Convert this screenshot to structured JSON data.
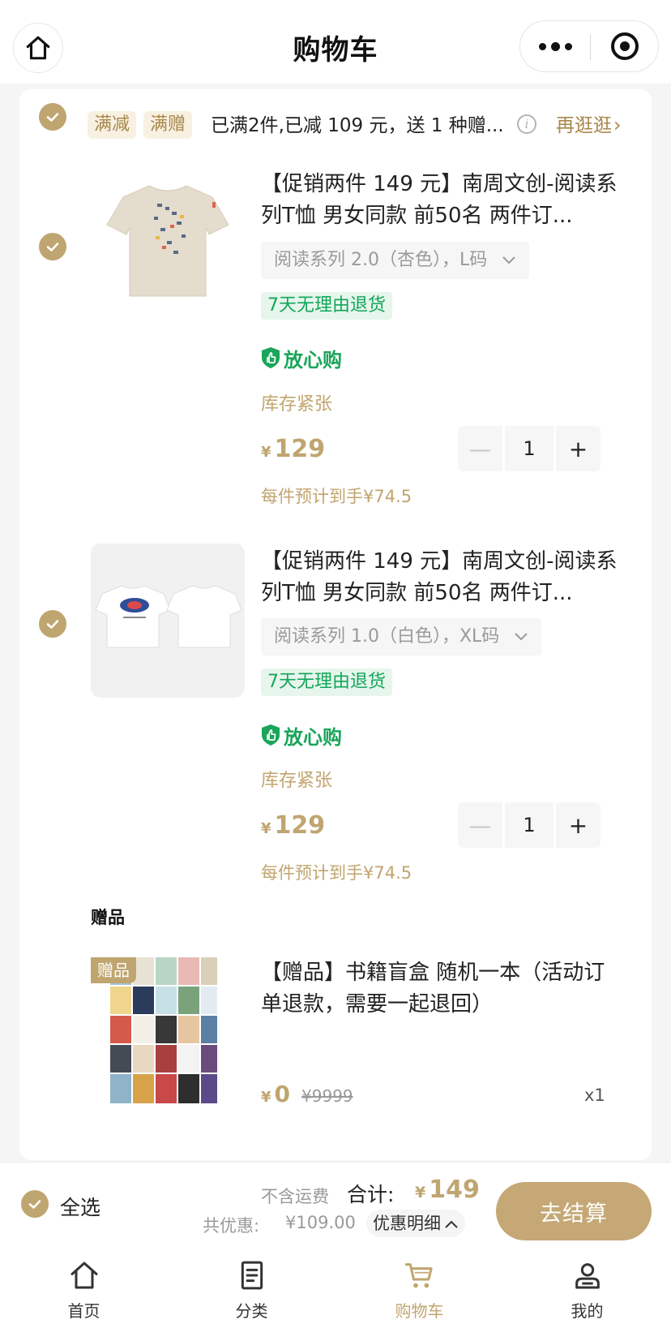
{
  "header": {
    "title": "购物车",
    "home_icon": "home-icon",
    "more_icon": "more-dots-icon",
    "close_icon": "target-close-icon"
  },
  "promo": {
    "tags": [
      "满减",
      "满赠"
    ],
    "text": "已满2件,已减 109 元，送 1 种赠...",
    "more_label": "再逛逛",
    "info_icon": "info-icon"
  },
  "items": [
    {
      "title": "【促销两件 149 元】南周文创-阅读系列T恤 男女同款 前50名 两件订...",
      "spec": "阅读系列 2.0（杏色），L码",
      "return_tag": "7天无理由退货",
      "assure": "放心购",
      "stock": "库存紧张",
      "currency": "¥",
      "price": "129",
      "qty": "1",
      "estimate": "每件预计到手¥74.5",
      "image": "beige-tshirt"
    },
    {
      "title": "【促销两件 149 元】南周文创-阅读系列T恤 男女同款 前50名 两件订...",
      "spec": "阅读系列 1.0（白色），XL码",
      "return_tag": "7天无理由退货",
      "assure": "放心购",
      "stock": "库存紧张",
      "currency": "¥",
      "price": "129",
      "qty": "1",
      "estimate": "每件预计到手¥74.5",
      "image": "white-tshirts"
    }
  ],
  "gift": {
    "heading": "赠品",
    "badge": "赠品",
    "title": "【赠品】书籍盲盒 随机一本（活动订单退款，需要一起退回）",
    "currency": "¥",
    "price": "0",
    "original_price": "¥9999",
    "qty": "x1"
  },
  "checkout": {
    "select_all": "全选",
    "shipping_note": "不含运费",
    "total_label": "合计:",
    "currency": "¥",
    "total": "149",
    "discount_label": "共优惠:",
    "discount_amount": "¥109.00",
    "discount_detail": "优惠明细",
    "pay_button": "去结算"
  },
  "tabbar": [
    {
      "label": "首页",
      "icon": "home-icon",
      "active": false
    },
    {
      "label": "分类",
      "icon": "category-icon",
      "active": false
    },
    {
      "label": "购物车",
      "icon": "cart-icon",
      "active": true
    },
    {
      "label": "我的",
      "icon": "user-icon",
      "active": false
    }
  ],
  "colors": {
    "accent": "#bfa56f",
    "green": "#13a65a",
    "background": "#f5f5f5"
  }
}
